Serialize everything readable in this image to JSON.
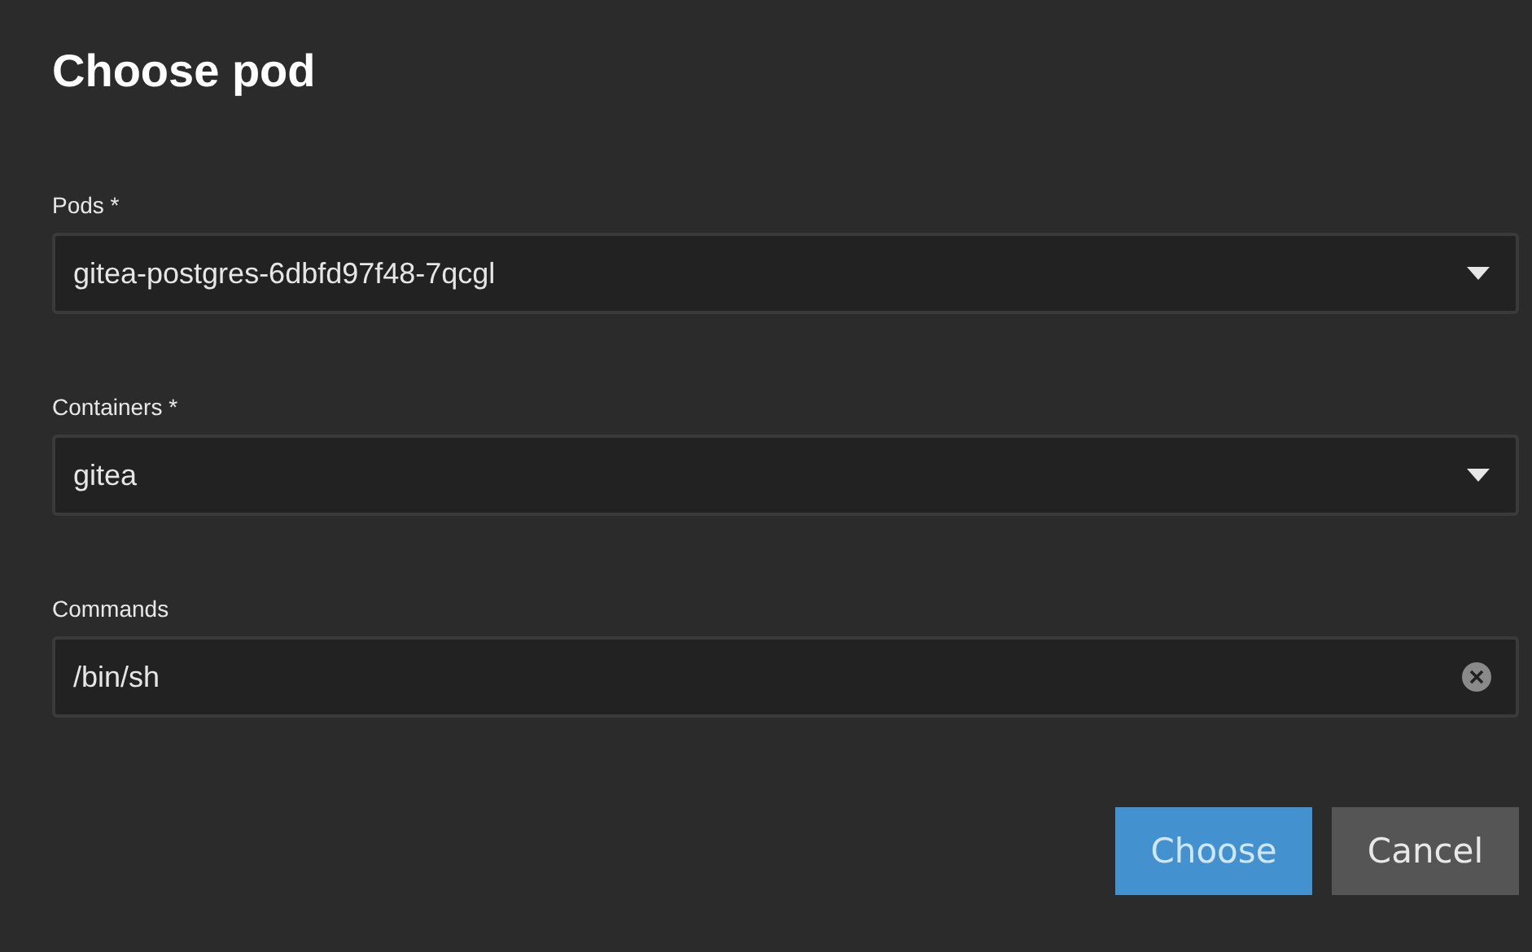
{
  "dialog": {
    "title": "Choose pod"
  },
  "fields": [
    {
      "kind": "select",
      "label": "Pods *",
      "value": "gitea-postgres-6dbfd97f48-7qcgl"
    },
    {
      "kind": "select",
      "label": "Containers *",
      "value": "gitea"
    },
    {
      "kind": "text",
      "label": "Commands",
      "value": "/bin/sh"
    }
  ],
  "buttons": [
    {
      "kind": "primary",
      "label": "Choose"
    },
    {
      "kind": "secondary",
      "label": "Cancel"
    }
  ]
}
